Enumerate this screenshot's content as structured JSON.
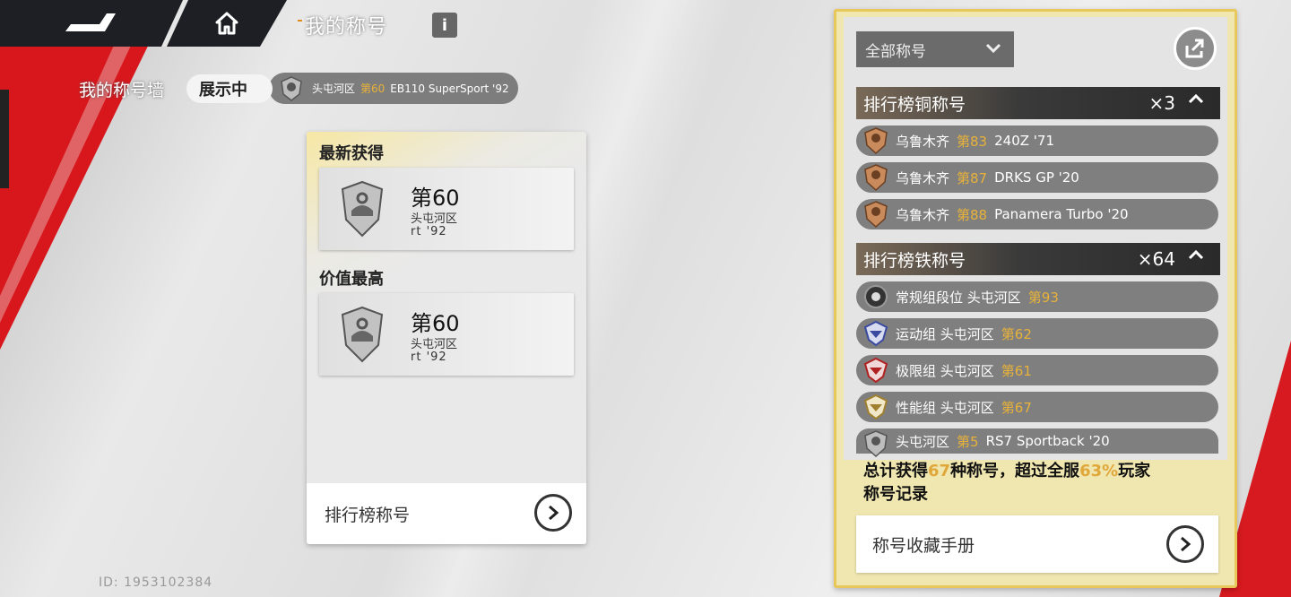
{
  "header": {
    "back_icon": "back-arrow-icon",
    "home_icon": "home-icon",
    "page_title": "我的称号",
    "info_label": "i"
  },
  "wall": {
    "label": "我的称号墙",
    "showing_label": "展示中",
    "showing_title": {
      "region": "头屯河区",
      "rank": "第60",
      "car": "EB110 SuperSport '92"
    }
  },
  "middle_panel": {
    "latest": {
      "heading": "最新获得",
      "rank": "第60",
      "region": "头屯河区",
      "car_partial": "rt  '92"
    },
    "highest": {
      "heading": "价值最高",
      "rank": "第60",
      "region": "头屯河区",
      "car_partial": "rt  '92"
    },
    "footer_label": "排行榜称号"
  },
  "right_panel": {
    "filter": "全部称号",
    "groups": [
      {
        "name": "排行榜铜称号",
        "count": "×3",
        "rows": [
          {
            "region": "乌鲁木齐",
            "rank": "第83",
            "car": "240Z '71"
          },
          {
            "region": "乌鲁木齐",
            "rank": "第87",
            "car": "DRKS GP '20"
          },
          {
            "region": "乌鲁木齐",
            "rank": "第88",
            "car": "Panamera Turbo '20"
          }
        ]
      },
      {
        "name": "排行榜铁称号",
        "count": "×64",
        "rows": [
          {
            "region": "常规组段位 头屯河区",
            "rank": "第93",
            "car": ""
          },
          {
            "region": "运动组 头屯河区",
            "rank": "第62",
            "car": ""
          },
          {
            "region": "极限组 头屯河区",
            "rank": "第61",
            "car": ""
          },
          {
            "region": "性能组 头屯河区",
            "rank": "第67",
            "car": ""
          },
          {
            "region": "头屯河区",
            "rank": "第5",
            "car": "RS7 Sportback '20"
          }
        ]
      }
    ],
    "summary": {
      "pre": "总计获得",
      "count": "67",
      "mid": "种称号，超过全服",
      "percent": "63%",
      "post": "玩家",
      "line2": "称号记录"
    },
    "footer_label": "称号收藏手册"
  },
  "uid": "ID: 1953102384",
  "colors": {
    "accent_red": "#d8171c",
    "gold": "#e8b23a",
    "panel_border": "#e8c85a"
  }
}
